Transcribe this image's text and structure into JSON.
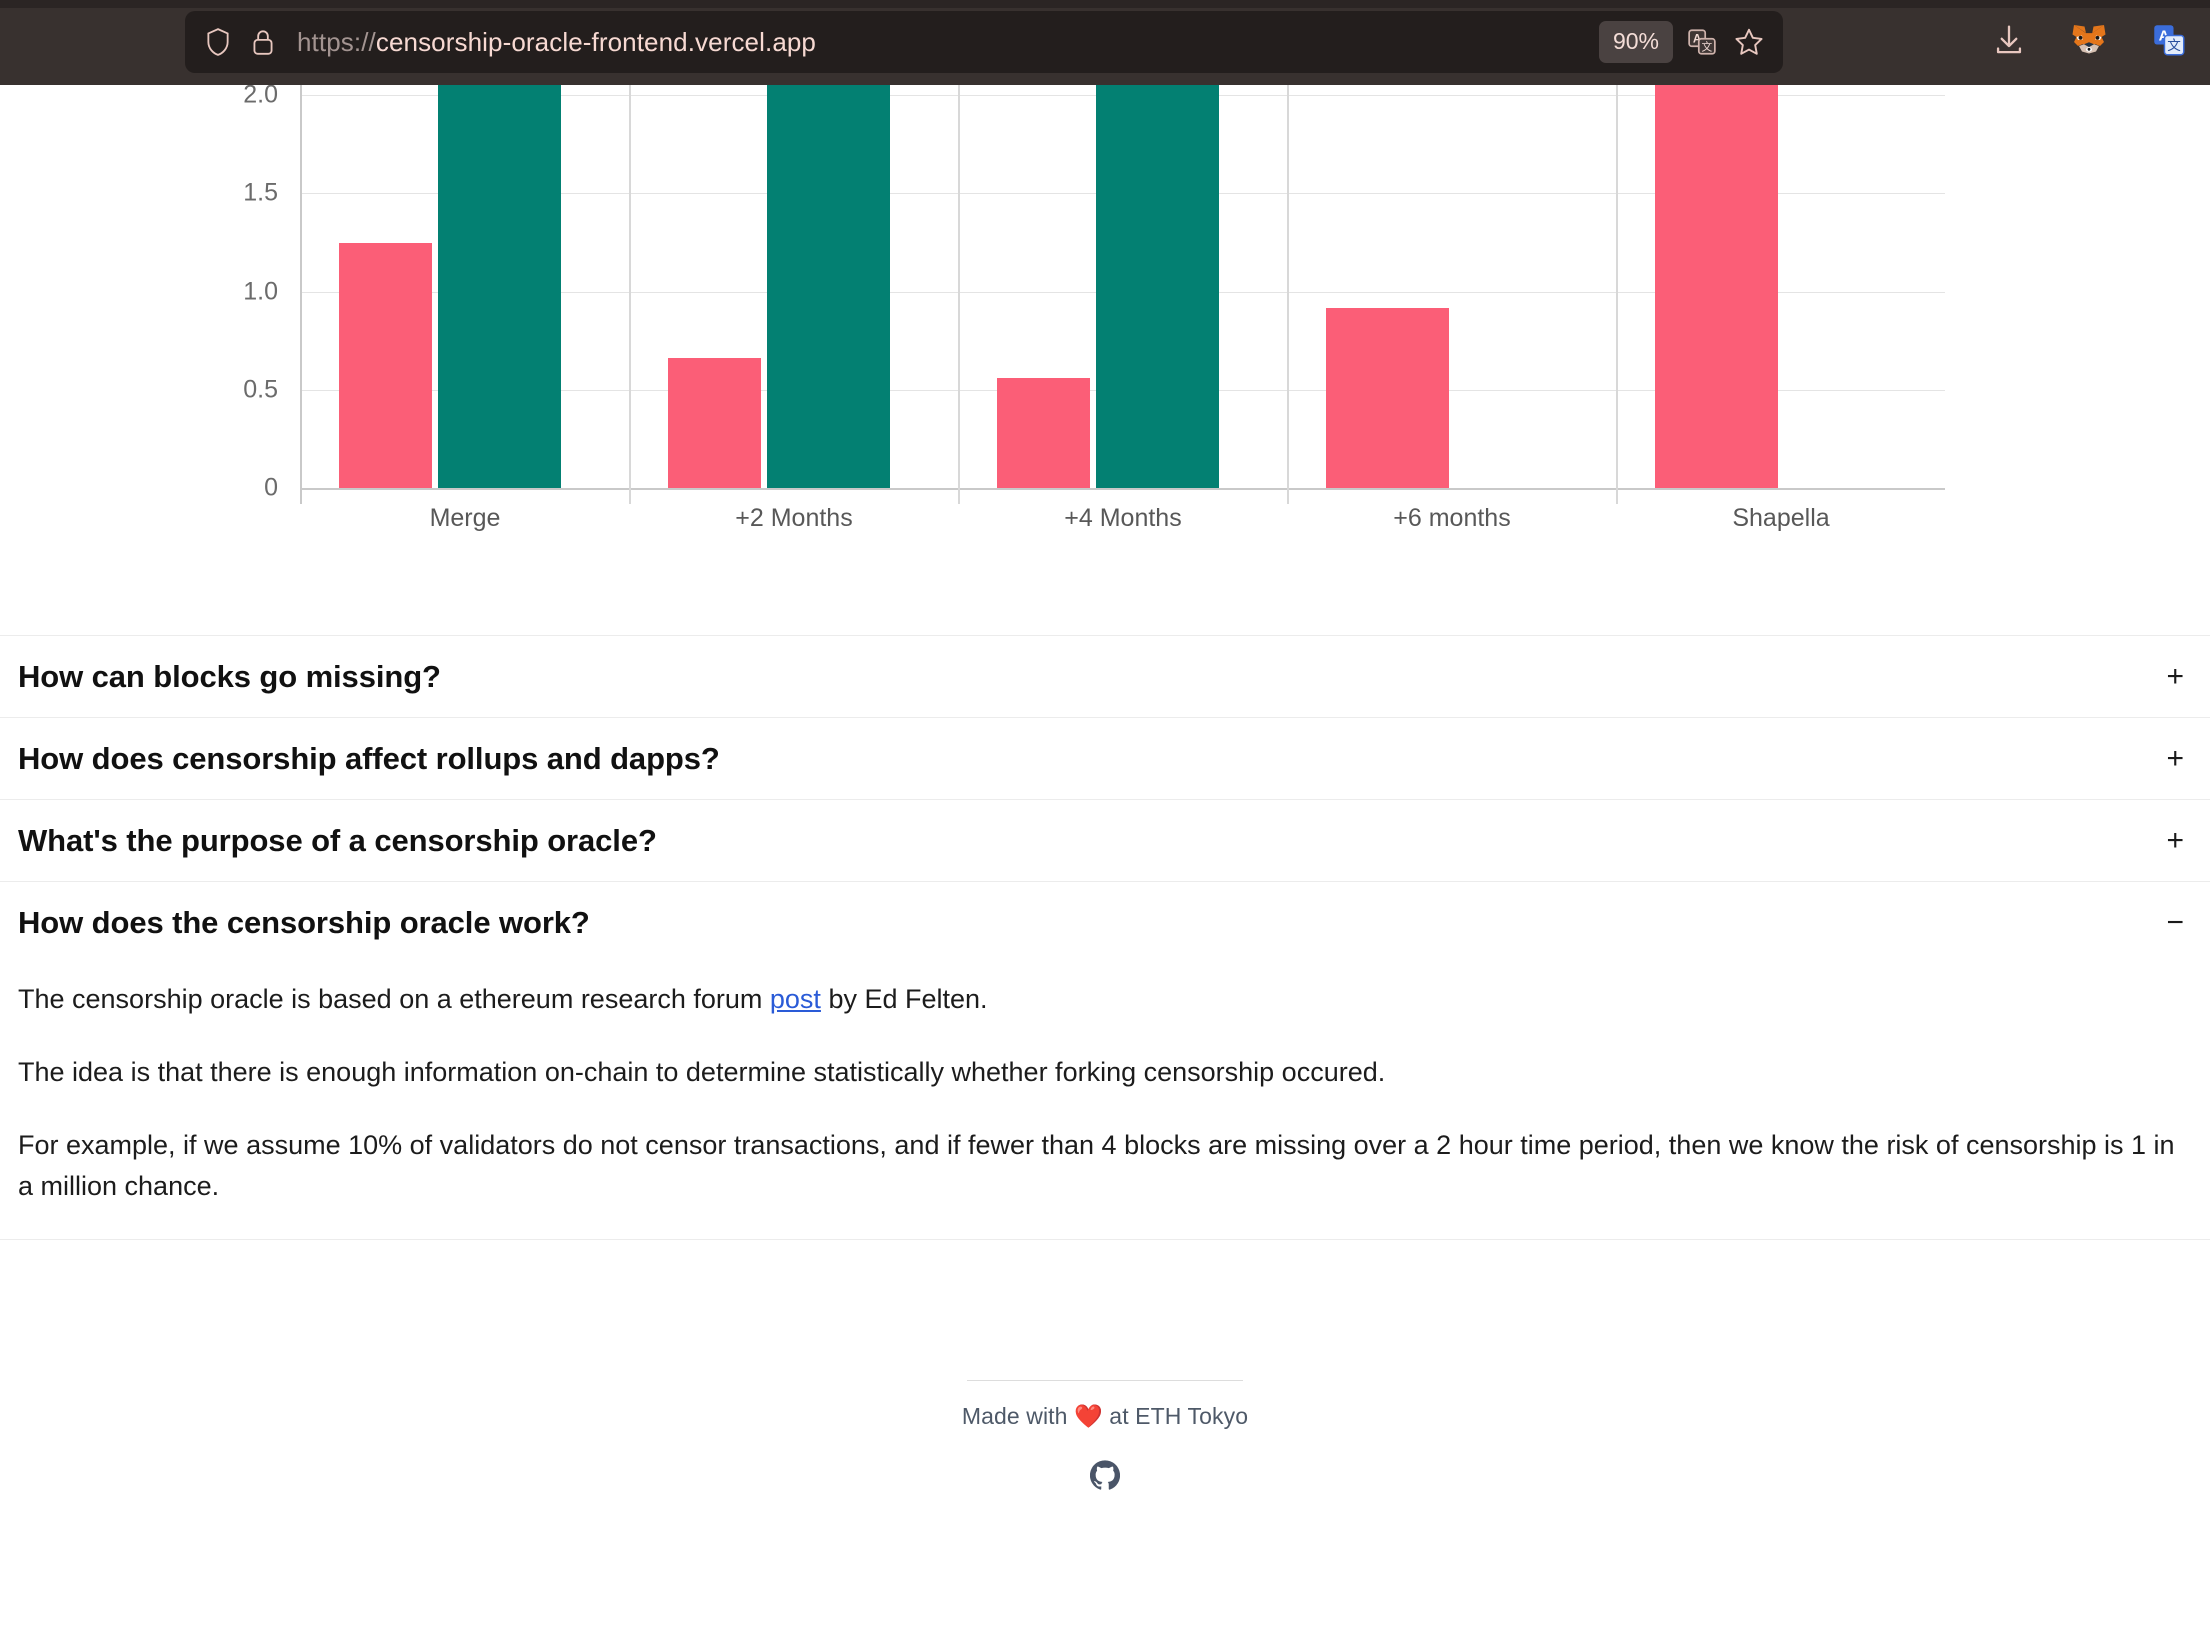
{
  "browser": {
    "url_scheme": "https://",
    "url_host": "censorship-oracle-frontend.vercel.app",
    "zoom_level": "90%",
    "icons": {
      "shield": "shield-icon",
      "lock": "padlock-icon",
      "translate": "translate-icon",
      "bookmark": "bookmark-star-icon",
      "downloads": "download-icon",
      "metamask": "metamask-fox-icon",
      "translate_extension": "translate-extension-icon"
    }
  },
  "chart_data": {
    "type": "bar",
    "title": "",
    "xlabel": "",
    "ylabel": "",
    "categories": [
      "Merge",
      "+2 Months",
      "+4 Months",
      "+6 months",
      "Shapella"
    ],
    "ytick_labels": [
      "0",
      "0.5",
      "1.0",
      "1.5",
      "2.0"
    ],
    "ytick_values": [
      0,
      0.5,
      1.0,
      1.5,
      2.0
    ],
    "ylim": [
      0,
      2.28
    ],
    "grid": true,
    "legend_position": "none",
    "series": [
      {
        "name": "pink-series",
        "color": "#fb5e77",
        "values": [
          1.24,
          0.655,
          0.555,
          0.905,
          2.45
        ]
      },
      {
        "name": "teal-series",
        "color": "#038072",
        "values": [
          2.45,
          2.45,
          2.45,
          null,
          null
        ]
      }
    ],
    "note": "Teal bars and the Shapella pink bar extend above the visible top edge of the viewport (clipped by scroll)."
  },
  "faq": {
    "items": [
      {
        "title": "How can blocks go missing?",
        "toggle": "+",
        "expanded": false
      },
      {
        "title": "How does censorship affect rollups and dapps?",
        "toggle": "+",
        "expanded": false
      },
      {
        "title": "What's the purpose of a censorship oracle?",
        "toggle": "+",
        "expanded": false
      },
      {
        "title": "How does the censorship oracle work?",
        "toggle": "−",
        "expanded": true
      }
    ],
    "expanded_body": {
      "p1_before_link": "The censorship oracle is based on a ethereum research forum ",
      "p1_link": "post",
      "p1_after_link": " by Ed Felten.",
      "p2": "The idea is that there is enough information on-chain to determine statistically whether forking censorship occured.",
      "p3": "For example, if we assume 10% of validators do not censor transactions, and if fewer than 4 blocks are missing over a 2 hour time period, then we know the risk of censorship is 1 in a million chance."
    }
  },
  "footer": {
    "text_before_heart": "Made with ",
    "heart": "❤️",
    "text_after_heart": " at ETH Tokyo",
    "github_label": "github-icon"
  }
}
